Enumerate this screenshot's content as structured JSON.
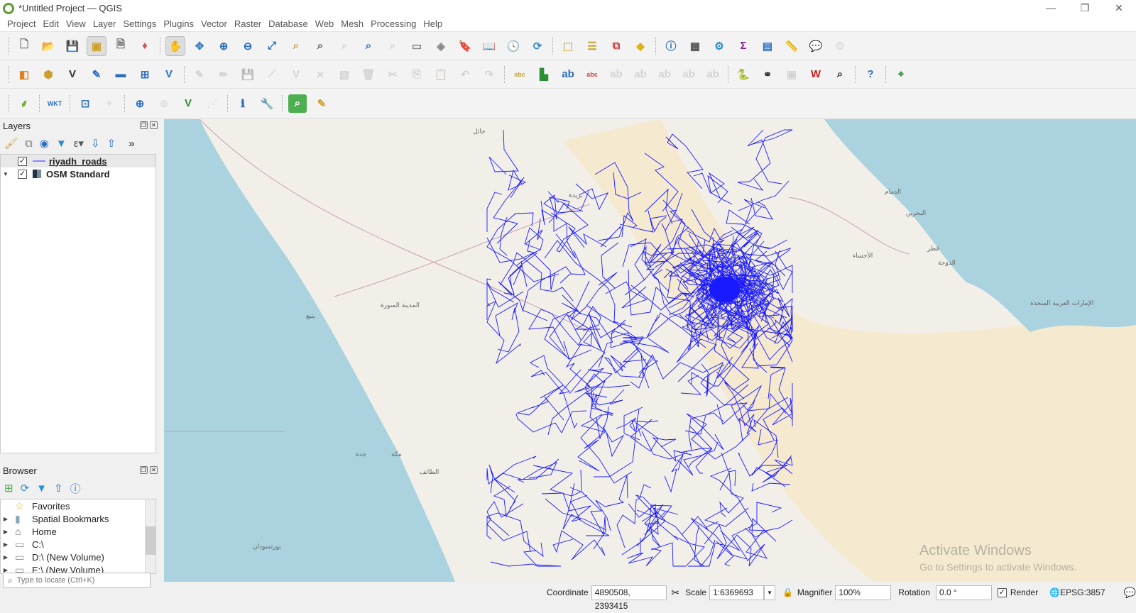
{
  "window": {
    "title": "*Untitled Project — QGIS",
    "controls": [
      "—",
      "❐",
      "✕"
    ]
  },
  "menu": [
    "Project",
    "Edit",
    "View",
    "Layer",
    "Settings",
    "Plugins",
    "Vector",
    "Raster",
    "Database",
    "Web",
    "Mesh",
    "Processing",
    "Help"
  ],
  "toolbars": [
    [
      {
        "n": "new-project-icon",
        "g": "🗋",
        "c": "#666"
      },
      {
        "n": "open-project-icon",
        "g": "📂",
        "c": "#e8b830"
      },
      {
        "n": "save-project-icon",
        "g": "💾",
        "c": "#4a6fa5"
      },
      {
        "n": "new-print-layout-icon",
        "g": "▣",
        "c": "#c9a030",
        "sel": true
      },
      {
        "n": "layout-manager-icon",
        "g": "🗎",
        "c": "#666"
      },
      {
        "n": "style-manager-icon",
        "g": "♦",
        "c": "#c55"
      },
      {
        "sep": true
      },
      {
        "n": "pan-icon",
        "g": "✋",
        "c": "#333",
        "sel": true
      },
      {
        "n": "pan-to-selection-icon",
        "g": "✥",
        "c": "#3a7fd0"
      },
      {
        "n": "zoom-in-icon",
        "g": "⊕",
        "c": "#2a6ec0"
      },
      {
        "n": "zoom-out-icon",
        "g": "⊖",
        "c": "#2a6ec0"
      },
      {
        "n": "zoom-full-icon",
        "g": "⤢",
        "c": "#2a6ec0"
      },
      {
        "n": "zoom-to-selection-icon",
        "g": "⌕",
        "c": "#c9a030"
      },
      {
        "n": "zoom-to-layer-icon",
        "g": "⌕",
        "c": "#555"
      },
      {
        "n": "zoom-native-icon",
        "g": "⌕",
        "c": "#999",
        "dis": true
      },
      {
        "n": "zoom-last-icon",
        "g": "⌕",
        "c": "#2a6ec0"
      },
      {
        "n": "zoom-next-icon",
        "g": "⌕",
        "c": "#999",
        "dis": true
      },
      {
        "n": "new-map-view-icon",
        "g": "▭",
        "c": "#888"
      },
      {
        "n": "new-3d-map-view-icon",
        "g": "◈",
        "c": "#888"
      },
      {
        "n": "new-spatial-bookmark-icon",
        "g": "🔖",
        "c": "#4a6fa5"
      },
      {
        "n": "show-bookmarks-icon",
        "g": "📖",
        "c": "#555"
      },
      {
        "n": "temporal-controller-icon",
        "g": "🕓",
        "c": "#555"
      },
      {
        "n": "refresh-icon",
        "g": "⟳",
        "c": "#2a8fd0"
      },
      {
        "sep": true
      },
      {
        "n": "select-features-icon",
        "g": "⬚",
        "c": "#c9a030"
      },
      {
        "n": "select-by-value-icon",
        "g": "☰",
        "c": "#c9a030"
      },
      {
        "n": "deselect-icon",
        "g": "⧉",
        "c": "#d04040"
      },
      {
        "n": "select-by-location-icon",
        "g": "◆",
        "c": "#e0b020"
      },
      {
        "sep": true
      },
      {
        "n": "identify-icon",
        "g": "ⓘ",
        "c": "#2a6ec0"
      },
      {
        "n": "attribute-table-icon",
        "g": "▦",
        "c": "#555"
      },
      {
        "n": "toolbox-gear-icon",
        "g": "⚙",
        "c": "#2a8fd0"
      },
      {
        "n": "statistics-sigma-icon",
        "g": "Σ",
        "c": "#8a2090"
      },
      {
        "n": "open-attribute-table-icon",
        "g": "▤",
        "c": "#2a6ec0"
      },
      {
        "n": "measure-icon",
        "g": "📏",
        "c": "#555"
      },
      {
        "n": "map-tips-icon",
        "g": "💬",
        "c": "#e0c020"
      },
      {
        "n": "lock-settings-icon",
        "g": "⚙",
        "c": "#bbb",
        "dis": true
      }
    ],
    [
      {
        "n": "data-source-manager-icon",
        "g": "◧",
        "c": "#e08020"
      },
      {
        "n": "new-geopackage-icon",
        "g": "⬢",
        "c": "#c9a030"
      },
      {
        "n": "new-shapefile-icon",
        "g": "V",
        "c": "#333"
      },
      {
        "n": "new-temp-scratch-layer-icon",
        "g": "✎",
        "c": "#2a6ec0"
      },
      {
        "n": "new-virtual-layer-icon",
        "g": "▬",
        "c": "#2a6ec0"
      },
      {
        "n": "new-mesh-layer-icon",
        "g": "⊞",
        "c": "#2a6ec0"
      },
      {
        "n": "new-vector-tile-icon",
        "g": "V",
        "c": "#2a6ec0"
      },
      {
        "sep": true
      },
      {
        "n": "current-edits-icon",
        "g": "✎",
        "c": "#999",
        "dis": true
      },
      {
        "n": "toggle-editing-icon",
        "g": "✏",
        "c": "#999",
        "dis": true
      },
      {
        "n": "save-edits-icon",
        "g": "💾",
        "c": "#999",
        "dis": true
      },
      {
        "n": "digitize-icon",
        "g": "⟋",
        "c": "#999",
        "dis": true
      },
      {
        "n": "vertex-tool-icon",
        "g": "V",
        "c": "#999",
        "dis": true
      },
      {
        "n": "modify-attributes-icon",
        "g": "⨯",
        "c": "#999",
        "dis": true
      },
      {
        "n": "edit-table-icon",
        "g": "▧",
        "c": "#999",
        "dis": true
      },
      {
        "n": "delete-selected-icon",
        "g": "🗑",
        "c": "#999",
        "dis": true
      },
      {
        "n": "cut-icon",
        "g": "✂",
        "c": "#999",
        "dis": true
      },
      {
        "n": "copy-icon",
        "g": "⎘",
        "c": "#999",
        "dis": true
      },
      {
        "n": "paste-icon",
        "g": "📋",
        "c": "#999",
        "dis": true
      },
      {
        "n": "undo-icon",
        "g": "↶",
        "c": "#999",
        "dis": true
      },
      {
        "n": "redo-icon",
        "g": "↷",
        "c": "#999",
        "dis": true
      },
      {
        "sep": true
      },
      {
        "n": "label-icon",
        "g": "abc",
        "c": "#c9a030"
      },
      {
        "n": "diagram-icon",
        "g": "▙",
        "c": "#2a9030"
      },
      {
        "n": "pin-labels-icon",
        "g": "ab",
        "c": "#2a6ec0"
      },
      {
        "n": "show-hide-labels-icon",
        "g": "abc",
        "c": "#d04040"
      },
      {
        "n": "move-label-icon",
        "g": "ab",
        "c": "#999",
        "dis": true
      },
      {
        "n": "rotate-label-icon",
        "g": "ab",
        "c": "#999",
        "dis": true
      },
      {
        "n": "change-label-icon",
        "g": "ab",
        "c": "#999",
        "dis": true
      },
      {
        "n": "label-props-icon",
        "g": "ab",
        "c": "#999",
        "dis": true
      },
      {
        "n": "unpin-label-icon",
        "g": "ab",
        "c": "#999",
        "dis": true
      },
      {
        "sep": true
      },
      {
        "n": "python-console-icon",
        "g": "🐍",
        "c": "#3a70a0"
      },
      {
        "n": "binoculars-icon",
        "g": "⚭",
        "c": "#333"
      },
      {
        "n": "plugin-disabled-icon",
        "g": "▣",
        "c": "#999",
        "dis": true
      },
      {
        "n": "wkt-tool-icon",
        "g": "W",
        "c": "#d02020"
      },
      {
        "n": "search-map-icon",
        "g": "⌕",
        "c": "#333"
      },
      {
        "sep": true
      },
      {
        "n": "help-icon",
        "g": "?",
        "c": "#2a6ec0"
      },
      {
        "sep": true
      },
      {
        "n": "georeferencer-icon",
        "g": "⌖",
        "c": "#2a9030"
      }
    ],
    [
      {
        "n": "leaf-plugin-icon",
        "g": "⸙",
        "c": "#6ab030"
      },
      {
        "sep": true
      },
      {
        "n": "wkt-icon",
        "g": "WKT",
        "c": "#2a6ec0"
      },
      {
        "sep": true
      },
      {
        "n": "coordinate-capture-icon",
        "g": "⊡",
        "c": "#2a6ec0"
      },
      {
        "n": "crosshair-icon",
        "g": "⌖",
        "c": "#bbb",
        "dis": true
      },
      {
        "sep": true
      },
      {
        "n": "shape-digitize-icon",
        "g": "⊕",
        "c": "#2a6ec0"
      },
      {
        "n": "snapping-icon",
        "g": "⊕",
        "c": "#bbb",
        "dis": true
      },
      {
        "n": "vertex-editor-icon",
        "g": "V",
        "c": "#2a9030"
      },
      {
        "n": "trace-icon",
        "g": "⋰",
        "c": "#bbb",
        "dis": true
      },
      {
        "sep": true
      },
      {
        "n": "info-icon",
        "g": "ℹ",
        "c": "#2a6ec0"
      },
      {
        "n": "wrench-icon",
        "g": "🔧",
        "c": "#555"
      },
      {
        "sep": true
      },
      {
        "n": "search-plugin-icon",
        "g": "⌕",
        "c": "#fff",
        "bg": "#4caf50"
      },
      {
        "n": "map-swipe-icon",
        "g": "✎",
        "c": "#c9a030"
      }
    ]
  ],
  "layers_panel": {
    "title": "Layers",
    "layers": [
      {
        "name": "riyadh_roads",
        "checked": true,
        "symbol_color": "#8888ff"
      },
      {
        "name": "OSM Standard",
        "checked": true
      }
    ]
  },
  "browser_panel": {
    "title": "Browser",
    "items": [
      {
        "label": "Favorites",
        "icon": "star-icon"
      },
      {
        "label": "Spatial Bookmarks",
        "icon": "bookmark-icon"
      },
      {
        "label": "Home",
        "icon": "home-icon"
      },
      {
        "label": "C:\\",
        "icon": "folder-icon"
      },
      {
        "label": "D:\\ (New Volume)",
        "icon": "folder-icon"
      },
      {
        "label": "E:\\ (New Volume)",
        "icon": "folder-icon"
      }
    ]
  },
  "locator": {
    "placeholder": "Type to locate (Ctrl+K)"
  },
  "status": {
    "coordinate_label": "Coordinate",
    "coordinate": "4890508, 2393415",
    "scale_label": "Scale",
    "scale": "1:6369693",
    "magnifier_label": "Magnifier",
    "magnifier": "100%",
    "rotation_label": "Rotation",
    "rotation": "0.0 °",
    "render_label": "Render",
    "render_checked": true,
    "crs": "EPSG:3857"
  },
  "map": {
    "colors": {
      "land": "#f2efe9",
      "sea": "#aad3df",
      "desert": "#f5ead0",
      "roads": "#1a1aff",
      "borders": "#c8a0b0"
    },
    "labels": [
      {
        "t": "حائل"
      },
      {
        "t": "بريدة"
      },
      {
        "t": "المدينة المنورة"
      },
      {
        "t": "ينبع"
      },
      {
        "t": "مكة"
      },
      {
        "t": "جدة"
      },
      {
        "t": "الطائف"
      },
      {
        "t": "الدمام"
      },
      {
        "t": "البحرين"
      },
      {
        "t": "قطر"
      },
      {
        "t": "الدوحة"
      },
      {
        "t": "الأحساء"
      },
      {
        "t": "الإمارات العربية المتحدة"
      },
      {
        "t": "بورتسودان"
      }
    ]
  },
  "watermark": {
    "line1": "Activate Windows",
    "line2": "Go to Settings to activate Windows."
  }
}
